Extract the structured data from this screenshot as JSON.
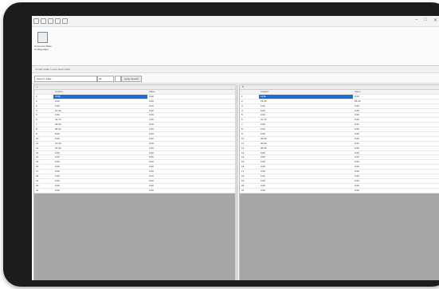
{
  "window": {
    "title": "",
    "controls": [
      "–",
      "□",
      "✕"
    ]
  },
  "ribbon": {
    "button_label_line1": "Customize Base",
    "button_label_line2": "Configuration"
  },
  "status_text": "Current scale: Lorem ipsum dolor",
  "controls": {
    "search_value": "Search / Filter",
    "select_value": "All",
    "action_label": "Apply Search"
  },
  "left_pane": {
    "title": "L",
    "headers": {
      "id": "",
      "caption": "Caption",
      "value": "Value"
    },
    "rows": [
      {
        "id": "1",
        "caption": "LINE",
        "value": "0.00"
      },
      {
        "id": "2",
        "caption": "0.00",
        "value": "0.00"
      },
      {
        "id": "3",
        "caption": "0.00",
        "value": "0.00"
      },
      {
        "id": "4",
        "caption": "14.00",
        "value": "0.00"
      },
      {
        "id": "5",
        "caption": "0.00",
        "value": "0.00"
      },
      {
        "id": "6",
        "caption": "41.75",
        "value": "4.25"
      },
      {
        "id": "7",
        "caption": "18.00",
        "value": "0.00"
      },
      {
        "id": "8",
        "caption": "36.00",
        "value": "0.00"
      },
      {
        "id": "9",
        "caption": "8.00",
        "value": "0.00"
      },
      {
        "id": "10",
        "caption": "0.00",
        "value": "0.00"
      },
      {
        "id": "11",
        "caption": "14.00",
        "value": "0.00"
      },
      {
        "id": "12",
        "caption": "21.00",
        "value": "0.00"
      },
      {
        "id": "13",
        "caption": "0.00",
        "value": "0.00"
      },
      {
        "id": "14",
        "caption": "0.00",
        "value": "0.00"
      },
      {
        "id": "15",
        "caption": "0.00",
        "value": "0.00"
      },
      {
        "id": "16",
        "caption": "0.00",
        "value": "0.00"
      },
      {
        "id": "17",
        "caption": "0.00",
        "value": "0.00"
      },
      {
        "id": "18",
        "caption": "0.00",
        "value": "0.00"
      },
      {
        "id": "19",
        "caption": "0.00",
        "value": "0.00"
      },
      {
        "id": "20",
        "caption": "0.00",
        "value": "0.00"
      },
      {
        "id": "21",
        "caption": "0.00",
        "value": "0.00"
      }
    ]
  },
  "right_pane": {
    "title": "R",
    "headers": {
      "id": "",
      "caption": "Caption",
      "value": "Value"
    },
    "rows": [
      {
        "id": "1",
        "caption": "LINE",
        "value": "0.00"
      },
      {
        "id": "2",
        "caption": "15.25",
        "value": "15.25"
      },
      {
        "id": "3",
        "caption": "0.00",
        "value": "0.00"
      },
      {
        "id": "4",
        "caption": "0.00",
        "value": "0.00"
      },
      {
        "id": "5",
        "caption": "0.00",
        "value": "0.00"
      },
      {
        "id": "6",
        "caption": "41.75",
        "value": "0.00"
      },
      {
        "id": "7",
        "caption": "0.00",
        "value": "0.00"
      },
      {
        "id": "8",
        "caption": "0.00",
        "value": "0.00"
      },
      {
        "id": "9",
        "caption": "0.00",
        "value": "0.00"
      },
      {
        "id": "10",
        "caption": "36.00",
        "value": "0.00"
      },
      {
        "id": "11",
        "caption": "36.00",
        "value": "0.00"
      },
      {
        "id": "12",
        "caption": "36.00",
        "value": "0.00"
      },
      {
        "id": "13",
        "caption": "0.00",
        "value": "0.00"
      },
      {
        "id": "14",
        "caption": "0.00",
        "value": "0.00"
      },
      {
        "id": "15",
        "caption": "0.00",
        "value": "0.00"
      },
      {
        "id": "16",
        "caption": "0.00",
        "value": "0.00"
      },
      {
        "id": "17",
        "caption": "0.00",
        "value": "0.00"
      },
      {
        "id": "18",
        "caption": "0.00",
        "value": "0.00"
      },
      {
        "id": "19",
        "caption": "0.00",
        "value": "0.00"
      },
      {
        "id": "20",
        "caption": "0.00",
        "value": "0.00"
      },
      {
        "id": "21",
        "caption": "0.00",
        "value": "0.00"
      }
    ]
  }
}
